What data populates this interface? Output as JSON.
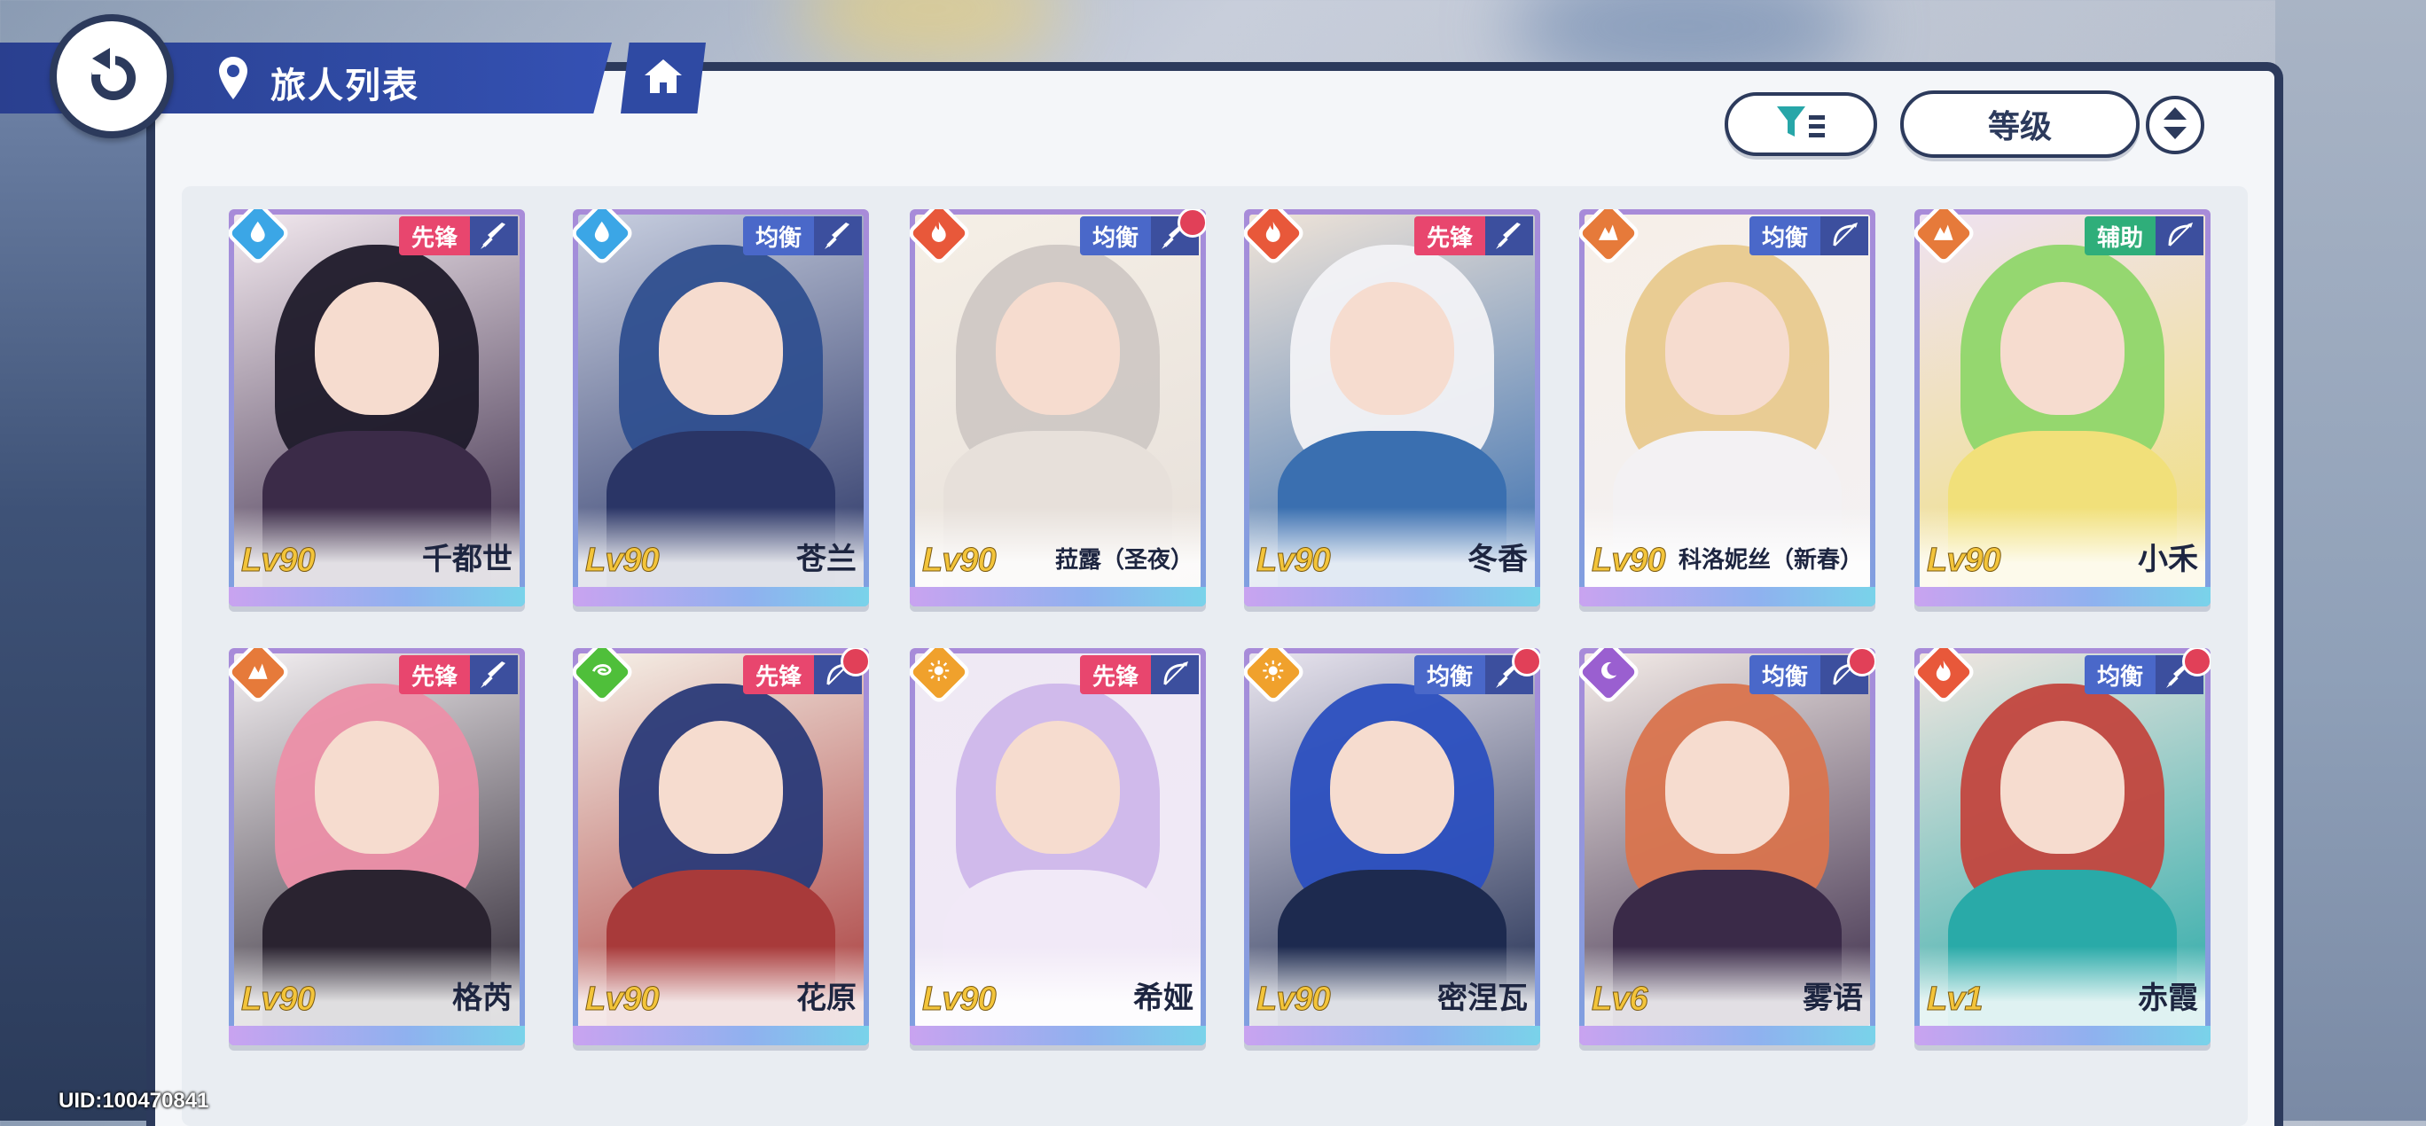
{
  "header": {
    "title": "旅人列表",
    "sort_label": "等级"
  },
  "colors": {
    "accent_dark": "#2c3a5c",
    "title_blue": "#2f4aa3",
    "role_vanguard": "#e8466e",
    "role_balanced": "#4a68c9",
    "role_support": "#2fae7a",
    "level_gold": "#f3c43a",
    "new_dot": "#e14058"
  },
  "cards": [
    {
      "level": "Lv90",
      "name": "千都世",
      "role": "先锋",
      "element": "water",
      "weapon": "sword",
      "new": false
    },
    {
      "level": "Lv90",
      "name": "苍兰",
      "role": "均衡",
      "element": "water",
      "weapon": "sword",
      "new": false
    },
    {
      "level": "Lv90",
      "name": "菈露（圣夜）",
      "role": "均衡",
      "element": "fire",
      "weapon": "sword",
      "new": true
    },
    {
      "level": "Lv90",
      "name": "冬香",
      "role": "先锋",
      "element": "fire",
      "weapon": "sword",
      "new": false
    },
    {
      "level": "Lv90",
      "name": "科洛妮丝（新春）",
      "role": "均衡",
      "element": "earth",
      "weapon": "bow",
      "new": false
    },
    {
      "level": "Lv90",
      "name": "小禾",
      "role": "辅助",
      "element": "earth",
      "weapon": "bow",
      "new": false
    },
    {
      "level": "Lv90",
      "name": "格芮",
      "role": "先锋",
      "element": "earth",
      "weapon": "sword",
      "new": false
    },
    {
      "level": "Lv90",
      "name": "花原",
      "role": "先锋",
      "element": "wind",
      "weapon": "bow",
      "new": true
    },
    {
      "level": "Lv90",
      "name": "希娅",
      "role": "先锋",
      "element": "light",
      "weapon": "bow",
      "new": false
    },
    {
      "level": "Lv90",
      "name": "密涅瓦",
      "role": "均衡",
      "element": "light",
      "weapon": "sword",
      "new": true
    },
    {
      "level": "Lv6",
      "name": "雾语",
      "role": "均衡",
      "element": "dark",
      "weapon": "bow",
      "new": true
    },
    {
      "level": "Lv1",
      "name": "赤霞",
      "role": "均衡",
      "element": "fire",
      "weapon": "sword",
      "new": true
    }
  ],
  "footer": {
    "uid": "UID:100470841"
  }
}
